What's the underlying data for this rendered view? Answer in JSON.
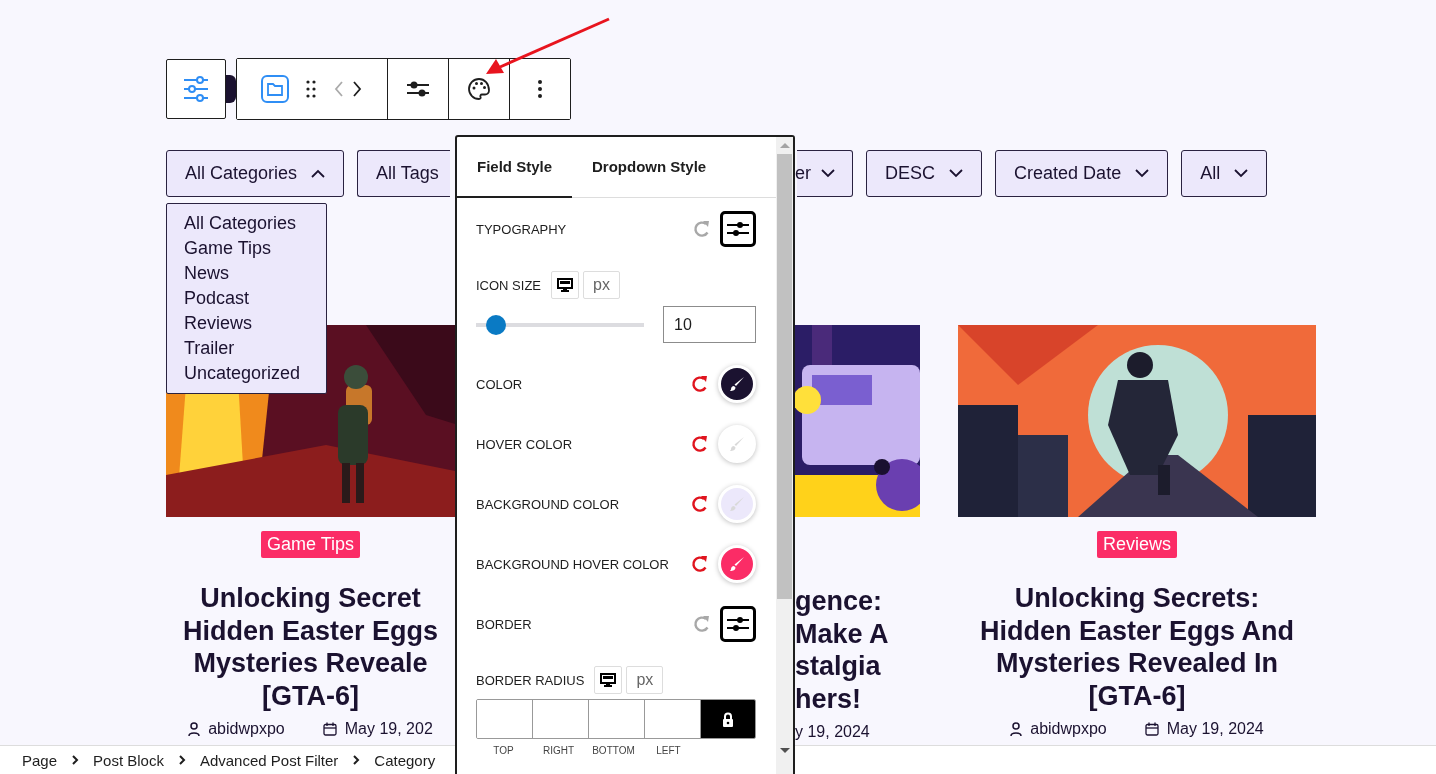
{
  "filters": [
    {
      "label": "All Categories",
      "expanded": true
    },
    {
      "label": "All Tags"
    },
    {
      "label": "er",
      "expanded": false
    },
    {
      "label": "DESC",
      "expanded": false
    },
    {
      "label": "Created Date",
      "expanded": false
    },
    {
      "label": "All",
      "expanded": false
    }
  ],
  "dropdown_options": [
    "All Categories",
    "Game Tips",
    "News",
    "Podcast",
    "Reviews",
    "Trailer",
    "Uncategorized"
  ],
  "posts": [
    {
      "category": "Game Tips",
      "title_lines": [
        "Unlocking Secret",
        "Hidden Easter Eggs",
        "Mysteries Reveale",
        "[GTA-6]"
      ],
      "author": "abidwpxpo",
      "date": "May 19, 202"
    },
    {
      "title_lines": [
        "gence:",
        "Make A",
        "stalgia",
        "hers!"
      ],
      "date": "y 19, 2024"
    },
    {
      "category": "Reviews",
      "title_lines": [
        "Unlocking Secrets:",
        "Hidden Easter Eggs And",
        "Mysteries Revealed In",
        "[GTA-6]"
      ],
      "author": "abidwpxpo",
      "date": "May 19, 2024"
    }
  ],
  "panel": {
    "tabs": [
      {
        "label": "Field Style",
        "selected": true
      },
      {
        "label": "Dropdown Style",
        "selected": false
      }
    ],
    "controls": [
      {
        "kind": "popover",
        "label": "TYPOGRAPHY",
        "modified": false
      },
      {
        "kind": "slider",
        "label": "ICON SIZE",
        "unit": "px",
        "level": 0.12,
        "value": "10"
      },
      {
        "kind": "color",
        "label": "COLOR",
        "modified": true,
        "color": "#1b1230"
      },
      {
        "kind": "color",
        "label": "HOVER COLOR",
        "modified": true,
        "color": "#ffffff"
      },
      {
        "kind": "color",
        "label": "BACKGROUND COLOR",
        "modified": true,
        "color": "#ece8fb"
      },
      {
        "kind": "color",
        "label": "BACKGROUND HOVER COLOR",
        "modified": true,
        "color": "#fb2c66"
      },
      {
        "kind": "popover",
        "label": "BORDER",
        "modified": false
      },
      {
        "kind": "dimensions",
        "label": "BORDER RADIUS",
        "unit": "px",
        "sides": [
          "TOP",
          "RIGHT",
          "BOTTOM",
          "LEFT"
        ]
      }
    ]
  },
  "breadcrumb": [
    "Page",
    "Post Block",
    "Advanced Post Filter",
    "Category"
  ]
}
